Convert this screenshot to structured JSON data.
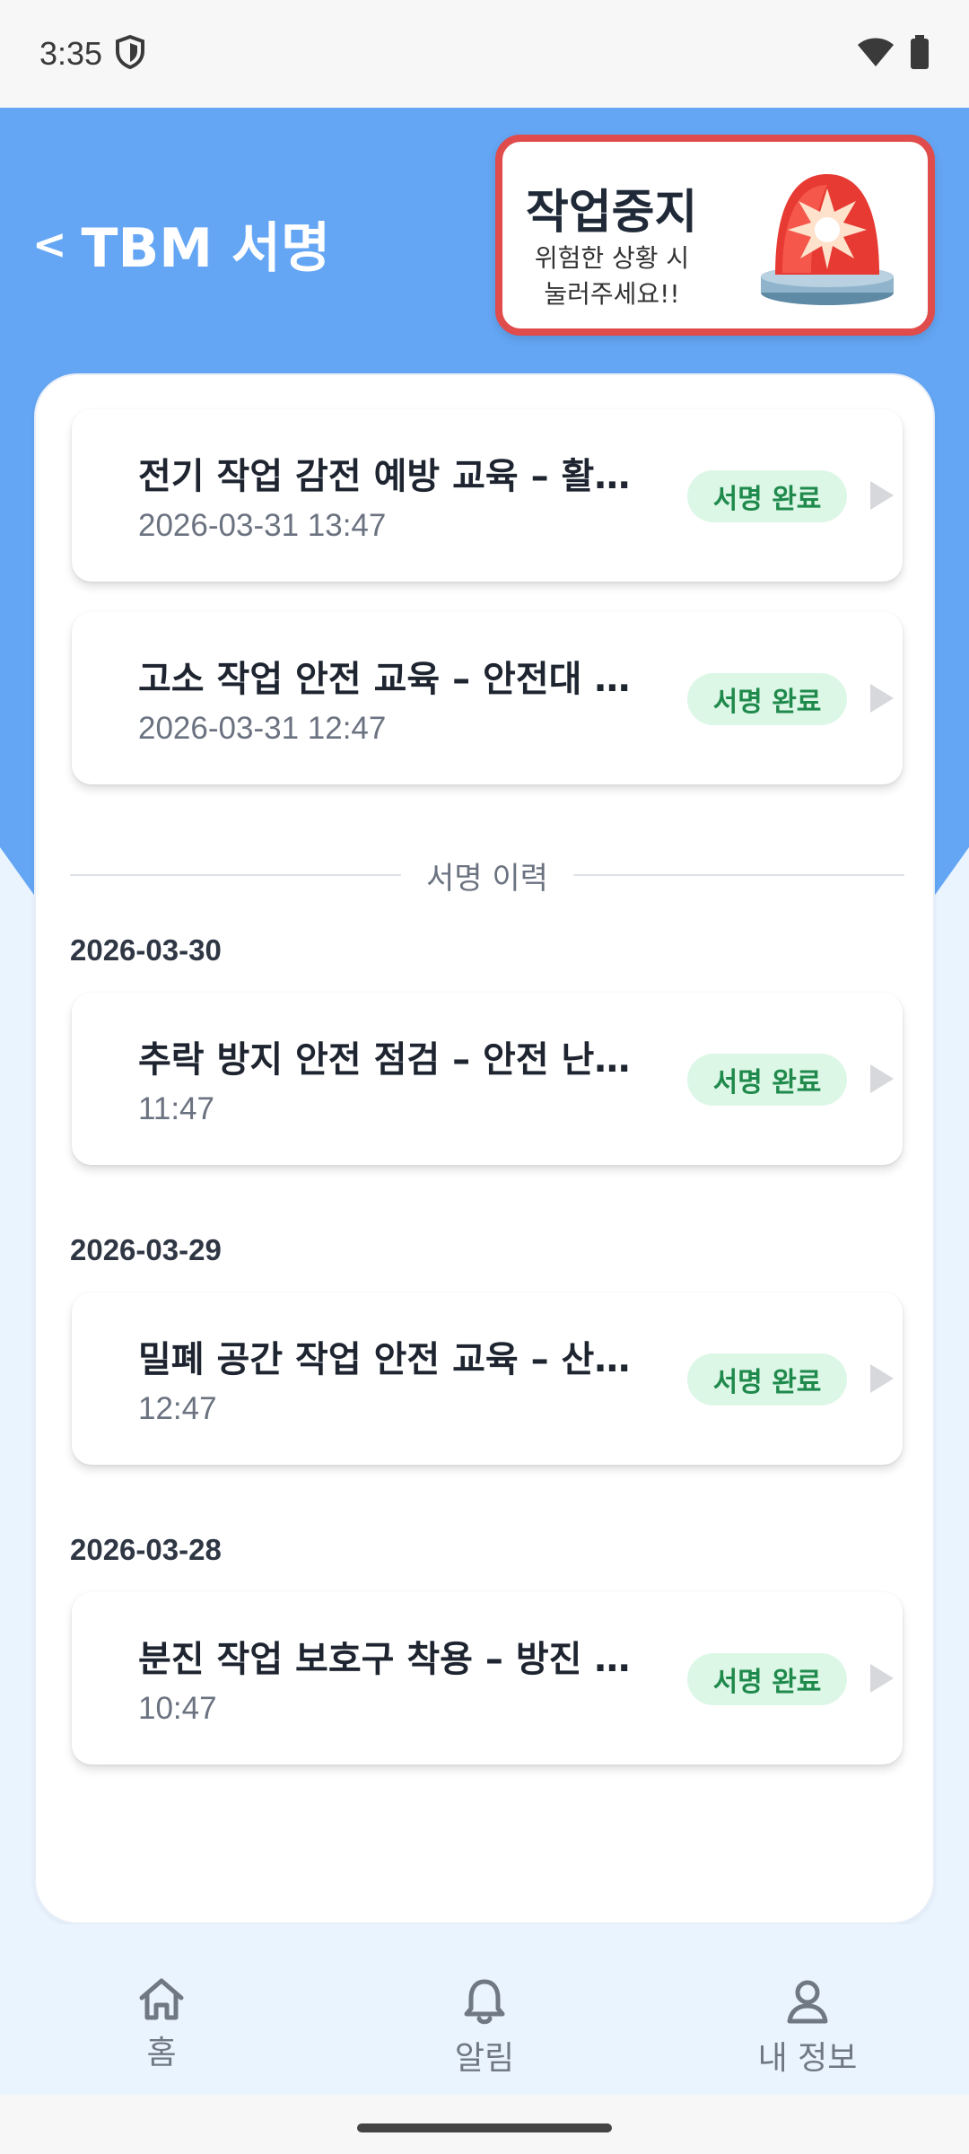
{
  "status_bar": {
    "time": "3:35"
  },
  "header": {
    "back_chevron": "<",
    "title": "TBM 서명"
  },
  "stop_button": {
    "title": "작업중지",
    "subtitle_line1": "위험한 상황 시",
    "subtitle_line2": "눌러주세요!!"
  },
  "current_items": [
    {
      "title": "전기 작업 감전 예방 교육 – 활선 작업 시 유의사항",
      "time": "2026-03-31 13:47",
      "status": "서명 완료"
    },
    {
      "title": "고소 작업 안전 교육 – 안전대 착용 및 점검",
      "time": "2026-03-31 12:47",
      "status": "서명 완료"
    }
  ],
  "history": {
    "label": "서명 이력",
    "groups": [
      {
        "date": "2026-03-30",
        "items": [
          {
            "title": "추락 방지 안전 점검 – 안전 난간 설치 확인",
            "time": "11:47",
            "status": "서명 완료"
          }
        ]
      },
      {
        "date": "2026-03-29",
        "items": [
          {
            "title": "밀폐 공간 작업 안전 교육 – 산소 농도 측정",
            "time": "12:47",
            "status": "서명 완료"
          }
        ]
      },
      {
        "date": "2026-03-28",
        "items": [
          {
            "title": "분진 작업 보호구 착용 – 방진 마스크 사용법",
            "time": "10:47",
            "status": "서명 완료"
          }
        ]
      }
    ]
  },
  "bottom_nav": {
    "home": "홈",
    "alerts": "알림",
    "profile": "내 정보"
  },
  "colors": {
    "header_blue": "#64a6f4",
    "stop_border": "#e04b4b",
    "badge_bg": "#ddf7e7",
    "badge_text": "#1f8a4c"
  },
  "icons": [
    "shield-icon",
    "wifi-icon",
    "battery-icon",
    "siren-icon",
    "play-icon",
    "home-icon",
    "bell-icon",
    "user-icon"
  ]
}
